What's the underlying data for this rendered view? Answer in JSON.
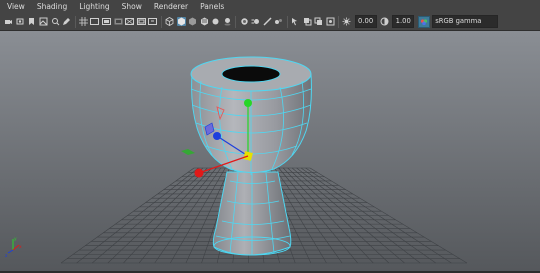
{
  "menus": [
    "View",
    "Shading",
    "Lighting",
    "Show",
    "Renderer",
    "Panels"
  ],
  "toolbar": {
    "exposure_value": "0.00",
    "gamma_value": "1.00",
    "color_space": "sRGB gamma",
    "colors": {
      "active": "#5285a6",
      "field_bg": "#2b2b2b"
    }
  },
  "viewport": {
    "background_top": "#898d93",
    "background_bottom": "#56595d",
    "wireframe_color": "#4fd7f2",
    "mesh_color": "#a0a2a7",
    "axis_x_color": "#e11919",
    "axis_y_color": "#27d627",
    "axis_z_color": "#1d3fdc"
  }
}
